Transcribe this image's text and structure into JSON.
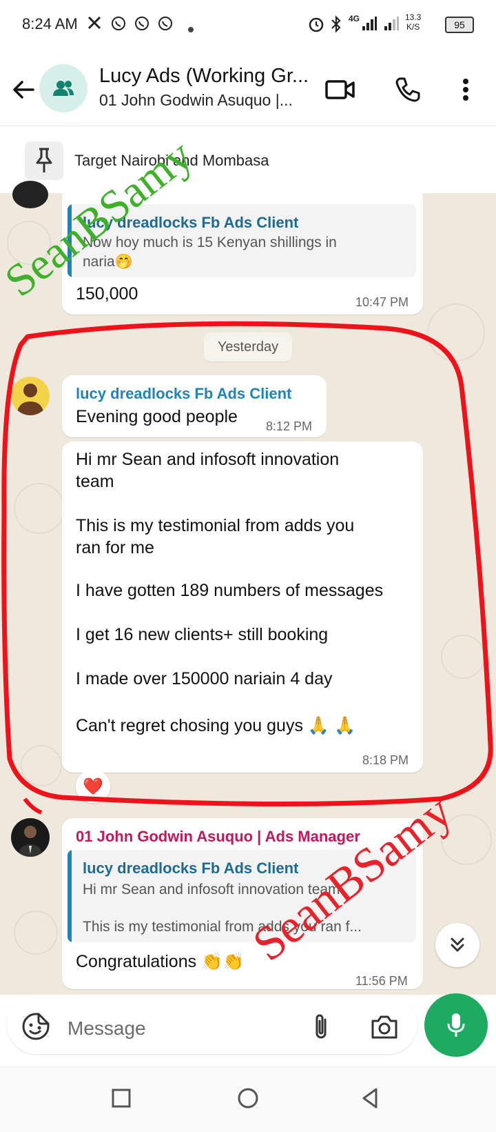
{
  "status_bar": {
    "time": "8:24 AM",
    "net_speed_value": "13.3",
    "net_speed_unit": "K/S",
    "battery": "95",
    "network": "4G",
    "icons": [
      "x-icon",
      "whatsapp-icon",
      "whatsapp-business-icon",
      "whatsapp-icon",
      "dot-icon",
      "alarm-icon",
      "bluetooth-icon",
      "signal-icon",
      "signal-icon",
      "battery-icon"
    ]
  },
  "header": {
    "title": "Lucy Ads (Working Gr...",
    "subtitle": "01 John Godwin Asuquo |..."
  },
  "pinned": {
    "text": "Target Nairobi and Mombasa"
  },
  "chat": {
    "top_message": {
      "quote_name": "lucy dreadlocks Fb Ads Client",
      "quote_line1": "Now hoy much is 15 Kenyan shillings in",
      "quote_line2": "naria🤭",
      "text": "150,000",
      "time": "10:47 PM"
    },
    "date_chip": "Yesterday",
    "msg1": {
      "sender": "lucy dreadlocks Fb Ads Client",
      "text": "Evening good people",
      "time": "8:12 PM"
    },
    "msg2": {
      "lines": [
        "Hi mr Sean and infosoft innovation",
        "team",
        "This is my testimonial from adds you",
        "ran for me",
        "I have gotten 189 numbers of messages",
        "I get 16 new clients+ still booking",
        "I made over 150000 nariain 4 day",
        "Can't regret chosing you guys 🙏 🙏"
      ],
      "time": "8:18 PM",
      "reaction": "❤️"
    },
    "msg3": {
      "sender": "01 John Godwin Asuquo | Ads Manager",
      "quote_name": "lucy dreadlocks Fb Ads Client",
      "quote_line1": "Hi mr Sean and infosoft innovation team",
      "quote_line2": "This is my testimonial from adds you ran f...",
      "text": "Congratulations 👏👏",
      "time": "11:56 PM"
    }
  },
  "composer": {
    "placeholder": "Message"
  },
  "watermark": {
    "text": "SeanBSamy",
    "color_green": "#3fb02a",
    "color_red": "#e8222b"
  },
  "colors": {
    "accent_green": "#1daa61",
    "sender_lucy": "#1f84b8",
    "sender_john": "#c2185b",
    "highlight": "#f0121b"
  }
}
